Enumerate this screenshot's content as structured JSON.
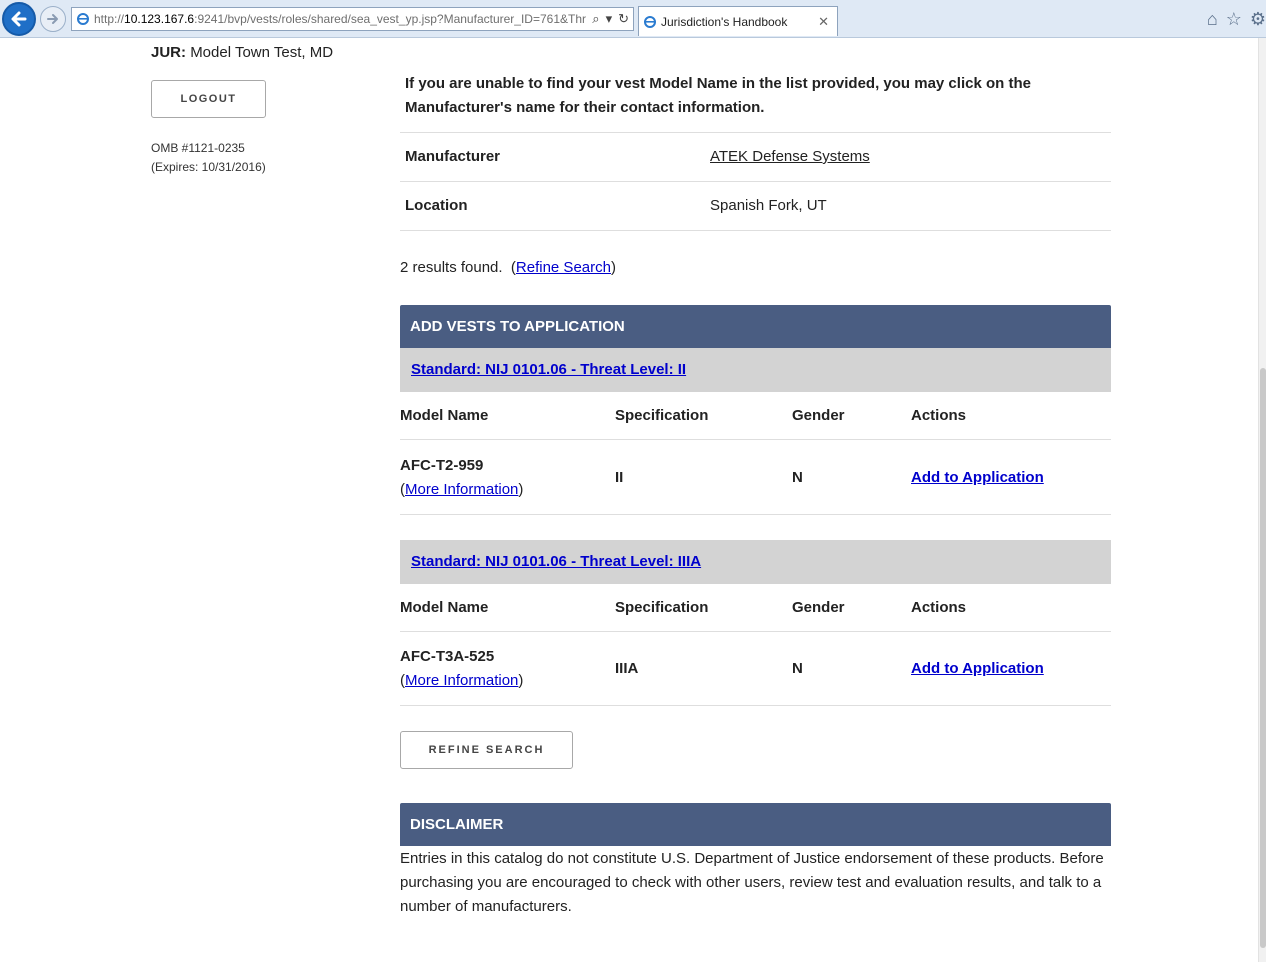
{
  "browser": {
    "url_prefix": "http://",
    "url_host": "10.123.167.6",
    "url_rest": ":9241/bvp/vests/roles/shared/sea_vest_yp.jsp?Manufacturer_ID=761&Thr",
    "tab_title": "Jurisdiction's Handbook"
  },
  "sidebar": {
    "jur_label": "JUR:",
    "jur_value": "Model Town Test, MD",
    "logout_label": "LOGOUT",
    "omb_number": "OMB #1121-0235",
    "omb_expires": "(Expires: 10/31/2016)"
  },
  "main": {
    "intro_line1": "If you are unable to find your vest Model Name in the list provided, you may click on the",
    "intro_line2": "Manufacturer's name for their contact information.",
    "manufacturer_label": "Manufacturer",
    "manufacturer_value": "ATEK Defense Systems",
    "location_label": "Location",
    "location_value": "Spanish Fork, UT",
    "results_count": "2 results found.",
    "results_refine_link": "Refine Search",
    "panel_title": "ADD VESTS TO APPLICATION",
    "columns": [
      "Model Name",
      "Specification",
      "Gender",
      "Actions"
    ],
    "groups": [
      {
        "standard": "Standard: NIJ 0101.06 - Threat Level: II",
        "rows": [
          {
            "model": "AFC-T2-959",
            "more": "More Information",
            "spec": "II",
            "gender": "N",
            "action": "Add to Application"
          }
        ]
      },
      {
        "standard": "Standard: NIJ 0101.06 - Threat Level: IIIA",
        "rows": [
          {
            "model": "AFC-T3A-525",
            "more": "More Information",
            "spec": "IIIA",
            "gender": "N",
            "action": "Add to Application"
          }
        ]
      }
    ],
    "refine_button": "REFINE SEARCH",
    "disclaimer_title": "DISCLAIMER",
    "disclaimer_text": "Entries in this catalog do not constitute U.S. Department of Justice endorsement of these products.  Before purchasing you are encouraged to check with other users, review test and evaluation results, and talk to a number of manufacturers."
  },
  "colors": {
    "panel_header": "#4a5d82",
    "standard_bar": "#d3d3d3",
    "link": "#0000cc",
    "browser_back": "#1f6fc7"
  },
  "icons": [
    "back-arrow-icon",
    "forward-arrow-icon",
    "ie-page-icon",
    "search-icon",
    "dropdown-icon",
    "refresh-icon",
    "tab-close-icon",
    "home-icon",
    "favorites-star-icon",
    "settings-gear-icon"
  ]
}
